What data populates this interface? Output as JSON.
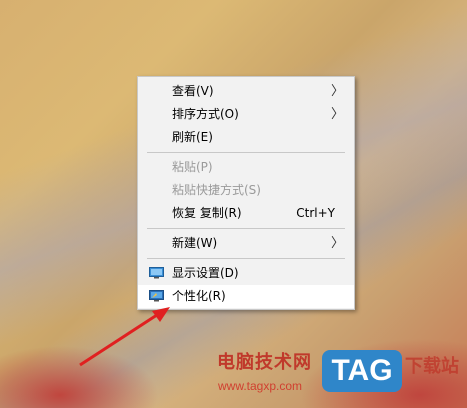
{
  "menu": {
    "items": [
      {
        "label": "查看(V)",
        "accel": "",
        "arrow": "〉",
        "disabled": false
      },
      {
        "label": "排序方式(O)",
        "accel": "",
        "arrow": "〉",
        "disabled": false
      },
      {
        "label": "刷新(E)",
        "accel": "",
        "arrow": "",
        "disabled": false
      },
      {
        "label": "粘贴(P)",
        "accel": "",
        "arrow": "",
        "disabled": true
      },
      {
        "label": "粘贴快捷方式(S)",
        "accel": "",
        "arrow": "",
        "disabled": true
      },
      {
        "label": "恢复 复制(R)",
        "accel": "Ctrl+Y",
        "arrow": "",
        "disabled": false
      },
      {
        "label": "新建(W)",
        "accel": "",
        "arrow": "〉",
        "disabled": false
      },
      {
        "label": "显示设置(D)",
        "accel": "",
        "arrow": "",
        "icon": "display-icon",
        "disabled": false
      },
      {
        "label": "个性化(R)",
        "accel": "",
        "arrow": "",
        "icon": "personalize-icon",
        "disabled": false,
        "hovered": true
      }
    ]
  },
  "watermark": {
    "site_name": "电脑技术网",
    "url": "www.tagxp.com",
    "logo": "TAG",
    "suffix": "下载站"
  },
  "colors": {
    "arrow": "#e02020",
    "menu_bg": "#f2f2f2",
    "logo_bg": "#2f86c9"
  }
}
